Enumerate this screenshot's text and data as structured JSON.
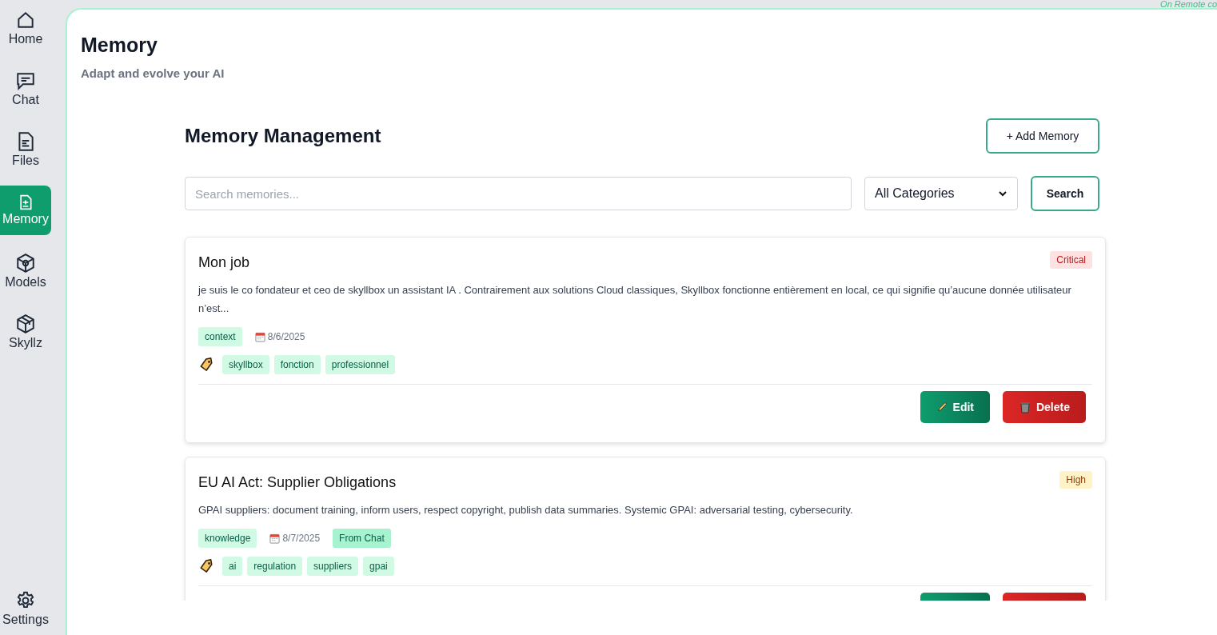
{
  "nav": [
    {
      "label": "Home",
      "selected": false
    },
    {
      "label": "Chat",
      "selected": false
    },
    {
      "label": "Files",
      "selected": false
    },
    {
      "label": "Memory",
      "selected": true
    },
    {
      "label": "Models",
      "selected": false
    },
    {
      "label": "Skyllz",
      "selected": false
    }
  ],
  "settings": {
    "label": "Settings"
  },
  "status": "On Remote co",
  "header": {
    "title": "Memory",
    "subtitle": "Adapt and evolve your AI"
  },
  "section": {
    "title": "Memory Management",
    "add_button": "+ Add Memory"
  },
  "search": {
    "placeholder": "Search memories...",
    "category": "All Categories",
    "button": "Search"
  },
  "memories": [
    {
      "title": "Mon job",
      "priority": {
        "label": "Critical",
        "kind": "critical"
      },
      "text": "je suis le co fondateur et ceo de skyllbox un assistant IA . Contrairement aux solutions Cloud classiques, Skyllbox fonctionne entièrement en local, ce qui signifie qu’aucune donnée utilisateur n’est...",
      "category": "context",
      "date": "8/6/2025",
      "tags": [
        "skyllbox",
        "fonction",
        "professionnel"
      ],
      "edit": "Edit",
      "delete": "Delete"
    },
    {
      "title": "EU AI Act: Supplier Obligations",
      "priority": {
        "label": "High",
        "kind": "high"
      },
      "text": "GPAI suppliers: document training, inform users, respect copyright, publish data summaries. Systemic GPAI: adversarial testing, cybersecurity.",
      "category": "knowledge",
      "date": "8/7/2025",
      "source": "From Chat",
      "tags": [
        "ai",
        "regulation",
        "suppliers",
        "gpai"
      ]
    }
  ]
}
